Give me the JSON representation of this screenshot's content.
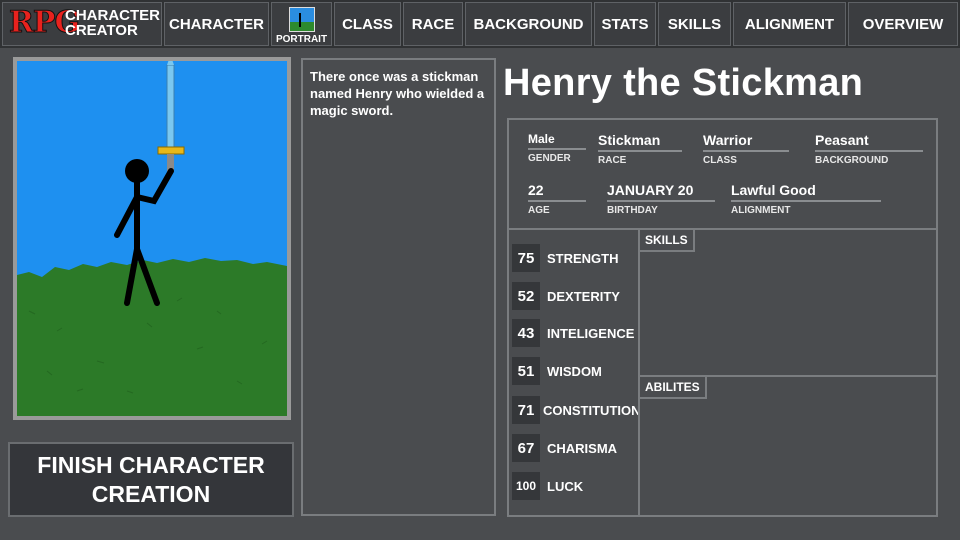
{
  "logo": {
    "rpg": "RPG",
    "line1": "CHARACTER",
    "line2": "CREATOR"
  },
  "nav": {
    "character": "CHARACTER",
    "portrait": "PORTRAIT",
    "class": "CLASS",
    "race": "RACE",
    "background": "BACKGROUND",
    "stats": "STATS",
    "skills": "SKILLS",
    "alignment": "ALIGNMENT",
    "overview": "OVERVIEW"
  },
  "finish_button": {
    "line1": "FINISH CHARACTER",
    "line2": "CREATION"
  },
  "story": "There once was a stickman named Henry who wielded a magic sword.",
  "character": {
    "name": "Henry the Stickman",
    "gender": {
      "value": "Male",
      "label": "GENDER"
    },
    "race": {
      "value": "Stickman",
      "label": "RACE"
    },
    "class": {
      "value": "Warrior",
      "label": "CLASS"
    },
    "background": {
      "value": "Peasant",
      "label": "BACKGROUND"
    },
    "age": {
      "value": "22",
      "label": "AGE"
    },
    "birthday": {
      "value": "JANUARY 20",
      "label": "BIRTHDAY"
    },
    "alignment": {
      "value": "Lawful Good",
      "label": "ALIGNMENT"
    }
  },
  "stats": [
    {
      "value": "75",
      "label": "STRENGTH"
    },
    {
      "value": "52",
      "label": "DEXTERITY"
    },
    {
      "value": "43",
      "label": "INTELIGENCE"
    },
    {
      "value": "51",
      "label": "WISDOM"
    },
    {
      "value": "71",
      "label": "CONSTITUTION"
    },
    {
      "value": "67",
      "label": "CHARISMA"
    },
    {
      "value": "100",
      "label": "LUCK"
    }
  ],
  "panels": {
    "skills": "SKILLS",
    "abilities": "ABILITES"
  },
  "colors": {
    "sky": "#1e90f0",
    "grass": "#2c7a28",
    "blade": "#7ac8f0",
    "hilt": "#e8b818",
    "logo_red": "#e8221e",
    "bg": "#4a4c4f"
  },
  "icons": {
    "portrait_tab": "stickman-thumbnail-icon"
  }
}
